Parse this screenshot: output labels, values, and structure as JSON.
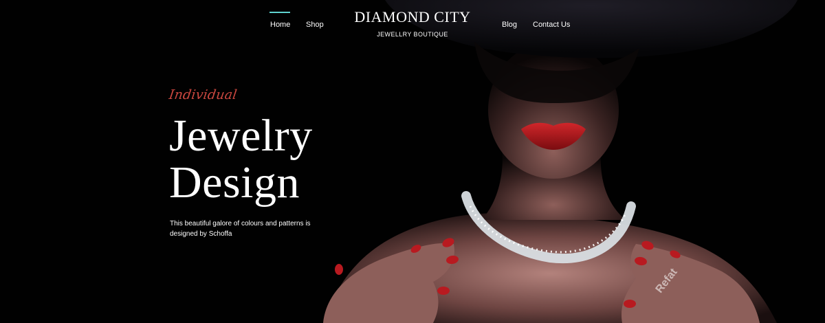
{
  "nav": {
    "left_links": [
      {
        "label": "Home",
        "active": true
      },
      {
        "label": "Shop",
        "active": false
      }
    ],
    "right_links": [
      {
        "label": "Blog",
        "active": false
      },
      {
        "label": "Contact Us",
        "active": false
      }
    ],
    "brand_title": "DIAMOND CITY",
    "brand_subtitle": "JEWELLRY BOUTIQUE",
    "active_indicator_color": "#5fd3d0"
  },
  "hero": {
    "eyebrow": "Individual",
    "headline_line1": "Jewelry",
    "headline_line2": "Design",
    "description": "This beautiful galore of colours and patterns is designed by Schoffa",
    "accent_color": "#c9473f",
    "watermark": "Refat"
  }
}
